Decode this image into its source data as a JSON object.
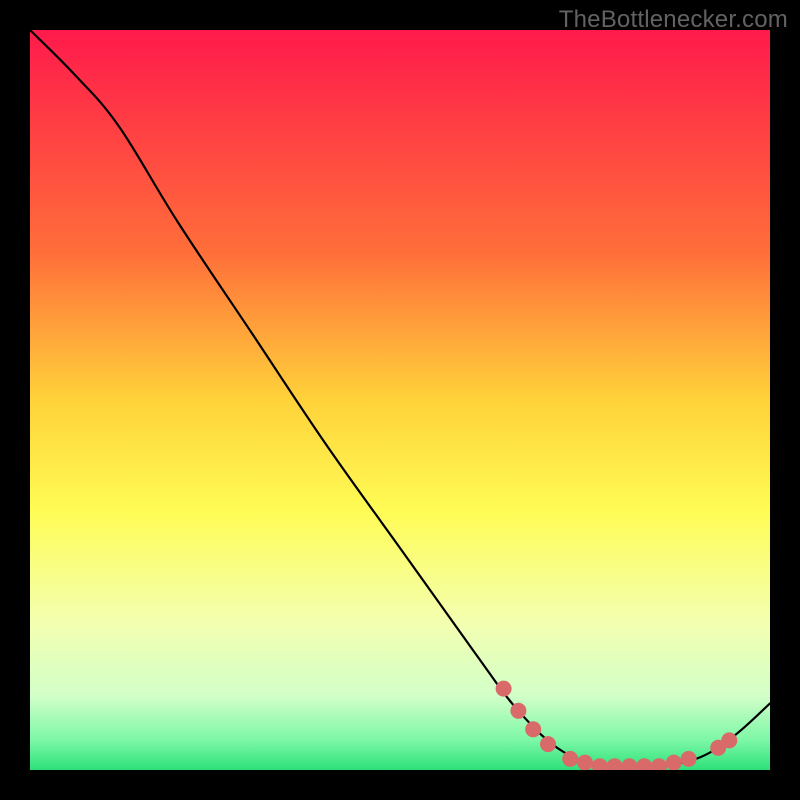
{
  "watermark": "TheBottlenecker.com",
  "chart_data": {
    "type": "line",
    "title": "",
    "xlabel": "",
    "ylabel": "",
    "xlim": [
      0,
      100
    ],
    "ylim": [
      0,
      100
    ],
    "gradient_stops": [
      {
        "offset": 0,
        "color": "#ff1a4b"
      },
      {
        "offset": 30,
        "color": "#ff6e3a"
      },
      {
        "offset": 50,
        "color": "#ffd23a"
      },
      {
        "offset": 65,
        "color": "#fffc55"
      },
      {
        "offset": 80,
        "color": "#f3ffb0"
      },
      {
        "offset": 90,
        "color": "#d2ffc8"
      },
      {
        "offset": 96,
        "color": "#7cf7a5"
      },
      {
        "offset": 100,
        "color": "#2de07a"
      }
    ],
    "curve": [
      {
        "x": 0,
        "y": 100
      },
      {
        "x": 6,
        "y": 94
      },
      {
        "x": 12,
        "y": 87
      },
      {
        "x": 20,
        "y": 74
      },
      {
        "x": 30,
        "y": 59
      },
      {
        "x": 40,
        "y": 44
      },
      {
        "x": 50,
        "y": 30
      },
      {
        "x": 60,
        "y": 16
      },
      {
        "x": 66,
        "y": 8
      },
      {
        "x": 72,
        "y": 2.5
      },
      {
        "x": 78,
        "y": 0.5
      },
      {
        "x": 84,
        "y": 0.5
      },
      {
        "x": 90,
        "y": 1.5
      },
      {
        "x": 95,
        "y": 4.5
      },
      {
        "x": 100,
        "y": 9
      }
    ],
    "markers": [
      {
        "x": 64,
        "y": 11
      },
      {
        "x": 66,
        "y": 8
      },
      {
        "x": 68,
        "y": 5.5
      },
      {
        "x": 70,
        "y": 3.5
      },
      {
        "x": 73,
        "y": 1.5
      },
      {
        "x": 75,
        "y": 1
      },
      {
        "x": 77,
        "y": 0.5
      },
      {
        "x": 79,
        "y": 0.5
      },
      {
        "x": 81,
        "y": 0.5
      },
      {
        "x": 83,
        "y": 0.5
      },
      {
        "x": 85,
        "y": 0.5
      },
      {
        "x": 87,
        "y": 1
      },
      {
        "x": 89,
        "y": 1.5
      },
      {
        "x": 93,
        "y": 3
      },
      {
        "x": 94.5,
        "y": 4
      }
    ],
    "marker_color": "#d86a6a",
    "marker_radius": 8,
    "line_color": "#000000",
    "line_width": 2.2
  }
}
